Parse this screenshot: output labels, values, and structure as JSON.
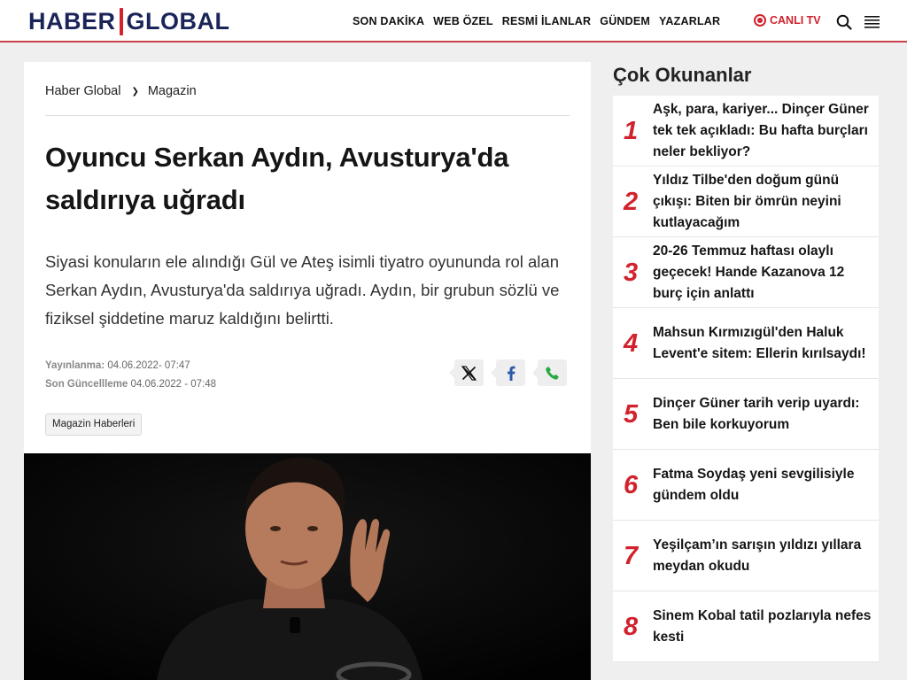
{
  "header": {
    "logo_left": "HABER",
    "logo_right": "GLOBAL",
    "nav": [
      "SON DAKİKA",
      "WEB ÖZEL",
      "RESMİ İLANLAR",
      "GÜNDEM",
      "YAZARLAR"
    ],
    "live_label": "CANLI TV",
    "icons": {
      "search": "search-icon",
      "menu": "hamburger-menu-icon",
      "live": "live-record-icon"
    },
    "colors": {
      "brand_navy": "#1b2459",
      "brand_red": "#d1222d"
    }
  },
  "article": {
    "breadcrumb": [
      "Haber Global",
      "Magazin"
    ],
    "title": "Oyuncu Serkan Aydın, Avusturya'da saldırıya uğradı",
    "summary": "Siyasi konuların ele alındığı Gül ve Ateş isimli tiyatro oyununda rol alan Serkan Aydın, Avusturya'da saldırıya uğradı. Aydın, bir grubun sözlü ve fiziksel şiddetine maruz kaldığını belirtti.",
    "published_label": "Yayınlanma:",
    "published_value": "04.06.2022- 07:47",
    "updated_label": "Son Güncellleme",
    "updated_value": "04.06.2022 - 07:48",
    "share_icons": [
      "x-twitter-icon",
      "facebook-icon",
      "whatsapp-phone-icon"
    ],
    "tag": "Magazin Haberleri"
  },
  "sidebar": {
    "title": "Çok Okunanlar",
    "items": [
      {
        "num": "1",
        "text": "Aşk, para, kariyer... Dinçer Güner tek tek açıkladı: Bu hafta burçları neler bekliyor?"
      },
      {
        "num": "2",
        "text": "Yıldız Tilbe'den doğum günü çıkışı: Biten bir ömrün neyini kutlayacağım"
      },
      {
        "num": "3",
        "text": "20-26 Temmuz haftası olaylı geçecek! Hande Kazanova 12 burç için anlattı"
      },
      {
        "num": "4",
        "text": "Mahsun Kırmızıgül'den Haluk Levent'e sitem: Ellerin kırılsaydı!"
      },
      {
        "num": "5",
        "text": "Dinçer Güner tarih verip uyardı: Ben bile korkuyorum"
      },
      {
        "num": "6",
        "text": "Fatma Soydaş yeni sevgilisiyle gündem oldu"
      },
      {
        "num": "7",
        "text": "Yeşilçam’ın sarışın yıldızı yıllara meydan okudu"
      },
      {
        "num": "8",
        "text": "Sinem Kobal tatil pozlarıyla nefes kesti"
      }
    ]
  }
}
